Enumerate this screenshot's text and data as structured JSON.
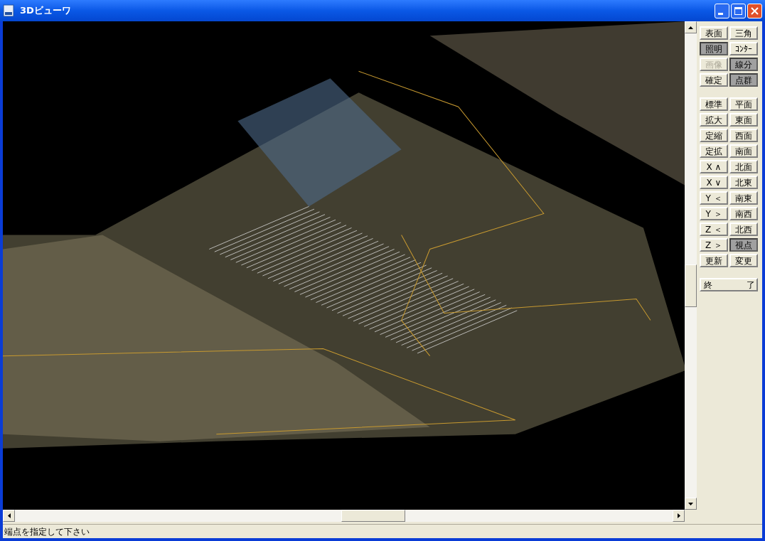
{
  "window": {
    "title": "3Dビューワ"
  },
  "button_groups": [
    {
      "rows": [
        [
          {
            "label": "表面",
            "pressed": false,
            "disabled": false
          },
          {
            "label": "三角",
            "pressed": false,
            "disabled": false
          }
        ],
        [
          {
            "label": "照明",
            "pressed": true,
            "disabled": false
          },
          {
            "label": "ｺﾝﾀｰ",
            "pressed": false,
            "disabled": false
          }
        ],
        [
          {
            "label": "画像",
            "pressed": false,
            "disabled": true
          },
          {
            "label": "線分",
            "pressed": true,
            "disabled": false
          }
        ],
        [
          {
            "label": "確定",
            "pressed": false,
            "disabled": false
          },
          {
            "label": "点群",
            "pressed": true,
            "disabled": false
          }
        ]
      ]
    },
    {
      "rows": [
        [
          {
            "label": "標準",
            "pressed": false,
            "disabled": false
          },
          {
            "label": "平面",
            "pressed": false,
            "disabled": false
          }
        ],
        [
          {
            "label": "拡大",
            "pressed": false,
            "disabled": false
          },
          {
            "label": "東面",
            "pressed": false,
            "disabled": false
          }
        ],
        [
          {
            "label": "定縮",
            "pressed": false,
            "disabled": false
          },
          {
            "label": "西面",
            "pressed": false,
            "disabled": false
          }
        ],
        [
          {
            "label": "定拡",
            "pressed": false,
            "disabled": false
          },
          {
            "label": "南面",
            "pressed": false,
            "disabled": false
          }
        ],
        [
          {
            "label": "X ∧",
            "pressed": false,
            "disabled": false
          },
          {
            "label": "北面",
            "pressed": false,
            "disabled": false
          }
        ],
        [
          {
            "label": "X ∨",
            "pressed": false,
            "disabled": false
          },
          {
            "label": "北東",
            "pressed": false,
            "disabled": false
          }
        ],
        [
          {
            "label": "Y ＜",
            "pressed": false,
            "disabled": false
          },
          {
            "label": "南東",
            "pressed": false,
            "disabled": false
          }
        ],
        [
          {
            "label": "Y ＞",
            "pressed": false,
            "disabled": false
          },
          {
            "label": "南西",
            "pressed": false,
            "disabled": false
          }
        ],
        [
          {
            "label": "Z ＜",
            "pressed": false,
            "disabled": false
          },
          {
            "label": "北西",
            "pressed": false,
            "disabled": false
          }
        ],
        [
          {
            "label": "Z ＞",
            "pressed": false,
            "disabled": false
          },
          {
            "label": "視点",
            "pressed": true,
            "disabled": false
          }
        ],
        [
          {
            "label": "更新",
            "pressed": false,
            "disabled": false
          },
          {
            "label": "変更",
            "pressed": false,
            "disabled": false
          }
        ]
      ]
    },
    {
      "rows": [
        [
          {
            "label": "終　　　　了",
            "pressed": false,
            "disabled": false
          }
        ]
      ]
    }
  ],
  "status_bar": {
    "text": "端点を指定して下さい"
  }
}
